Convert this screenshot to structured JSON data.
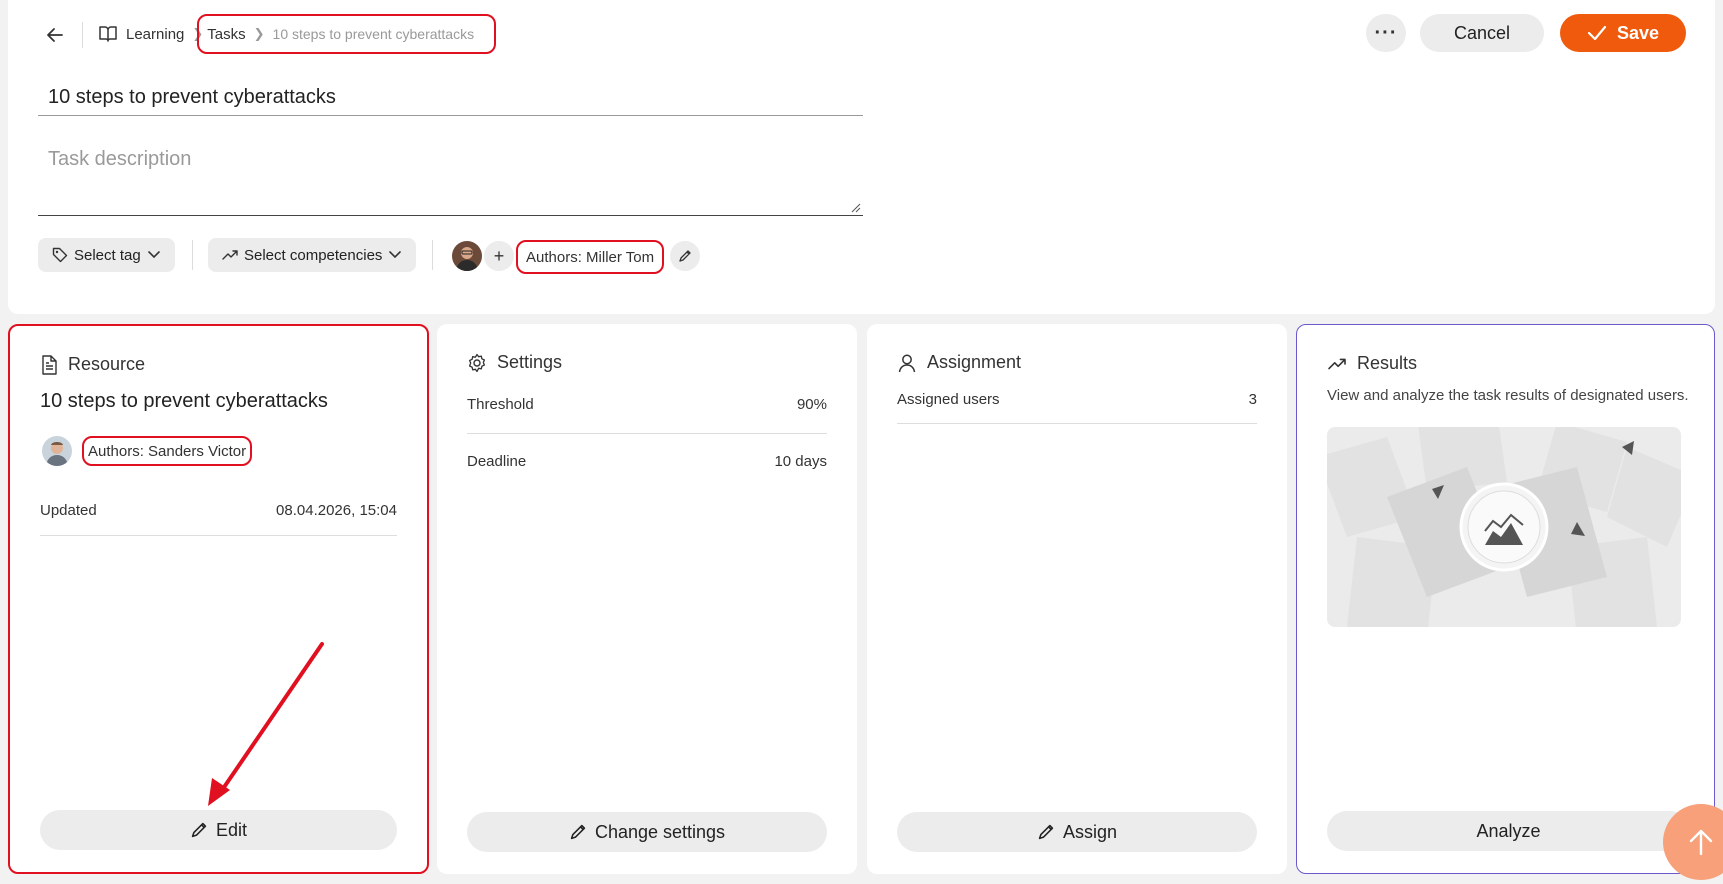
{
  "header": {
    "breadcrumb": {
      "root": "Learning",
      "parent": "Tasks",
      "current": "10 steps to prevent cyberattacks"
    },
    "more_label": "···",
    "cancel_label": "Cancel",
    "save_label": "Save"
  },
  "task": {
    "title": "10 steps to prevent cyberattacks",
    "description_placeholder": "Task description"
  },
  "toolbar": {
    "tag_label": "Select tag",
    "competencies_label": "Select competencies",
    "authors_label": "Authors: Miller Tom"
  },
  "cards": {
    "resource": {
      "heading": "Resource",
      "title": "10 steps to prevent cyberattacks",
      "authors": "Authors: Sanders Victor",
      "updated_label": "Updated",
      "updated_value": "08.04.2026, 15:04",
      "button": "Edit"
    },
    "settings": {
      "heading": "Settings",
      "threshold_label": "Threshold",
      "threshold_value": "90%",
      "deadline_label": "Deadline",
      "deadline_value": "10 days",
      "button": "Change settings"
    },
    "assignment": {
      "heading": "Assignment",
      "assigned_label": "Assigned users",
      "assigned_value": "3",
      "button": "Assign"
    },
    "results": {
      "heading": "Results",
      "description": "View and analyze the task results of designated users.",
      "button": "Analyze"
    }
  },
  "colors": {
    "accent": "#f05a0c",
    "highlight": "#e01020",
    "results_border": "#6a5acd"
  }
}
